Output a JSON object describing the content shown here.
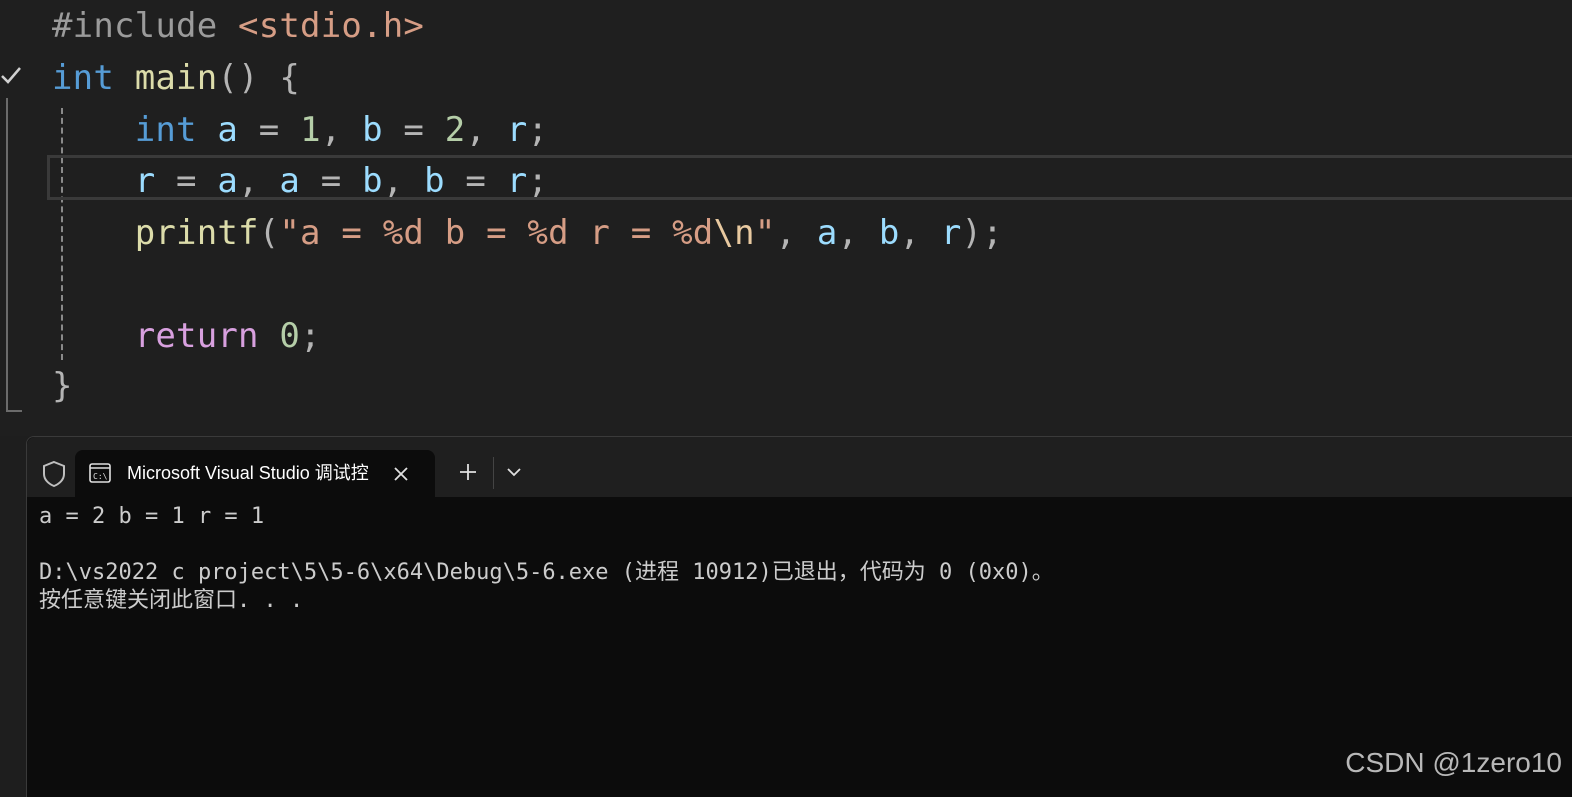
{
  "editor": {
    "lines": [
      [
        {
          "t": "#include ",
          "c": "c-pre"
        },
        {
          "t": "<stdio.h>",
          "c": "c-str"
        }
      ],
      [
        {
          "t": "int",
          "c": "c-kw"
        },
        {
          "t": " ",
          "c": "c-op"
        },
        {
          "t": "main",
          "c": "c-fn"
        },
        {
          "t": "() ",
          "c": "c-punc"
        },
        {
          "t": "{",
          "c": "c-brace"
        }
      ],
      [
        {
          "t": "    ",
          "c": "c-op"
        },
        {
          "t": "int",
          "c": "c-kw"
        },
        {
          "t": " ",
          "c": "c-op"
        },
        {
          "t": "a",
          "c": "c-var"
        },
        {
          "t": " = ",
          "c": "c-op"
        },
        {
          "t": "1",
          "c": "c-num"
        },
        {
          "t": ", ",
          "c": "c-punc"
        },
        {
          "t": "b",
          "c": "c-var"
        },
        {
          "t": " = ",
          "c": "c-op"
        },
        {
          "t": "2",
          "c": "c-num"
        },
        {
          "t": ", ",
          "c": "c-punc"
        },
        {
          "t": "r",
          "c": "c-var"
        },
        {
          "t": ";",
          "c": "c-punc"
        }
      ],
      [
        {
          "t": "    ",
          "c": "c-op"
        },
        {
          "t": "r",
          "c": "c-var"
        },
        {
          "t": " = ",
          "c": "c-op"
        },
        {
          "t": "a",
          "c": "c-var"
        },
        {
          "t": ", ",
          "c": "c-punc"
        },
        {
          "t": "a",
          "c": "c-var"
        },
        {
          "t": " = ",
          "c": "c-op"
        },
        {
          "t": "b",
          "c": "c-var"
        },
        {
          "t": ", ",
          "c": "c-punc"
        },
        {
          "t": "b",
          "c": "c-var"
        },
        {
          "t": " = ",
          "c": "c-op"
        },
        {
          "t": "r",
          "c": "c-var"
        },
        {
          "t": ";",
          "c": "c-punc"
        }
      ],
      [
        {
          "t": "    ",
          "c": "c-op"
        },
        {
          "t": "printf",
          "c": "c-fn"
        },
        {
          "t": "(",
          "c": "c-punc"
        },
        {
          "t": "\"a = %d b = %d r = %d",
          "c": "c-str"
        },
        {
          "t": "\\n",
          "c": "c-esc"
        },
        {
          "t": "\"",
          "c": "c-str"
        },
        {
          "t": ", ",
          "c": "c-punc"
        },
        {
          "t": "a",
          "c": "c-var"
        },
        {
          "t": ", ",
          "c": "c-punc"
        },
        {
          "t": "b",
          "c": "c-var"
        },
        {
          "t": ", ",
          "c": "c-punc"
        },
        {
          "t": "r",
          "c": "c-var"
        },
        {
          "t": ");",
          "c": "c-punc"
        }
      ],
      [],
      [
        {
          "t": "    ",
          "c": "c-op"
        },
        {
          "t": "return",
          "c": "c-ret"
        },
        {
          "t": " ",
          "c": "c-op"
        },
        {
          "t": "0",
          "c": "c-num"
        },
        {
          "t": ";",
          "c": "c-punc"
        }
      ],
      [
        {
          "t": "}",
          "c": "c-brace"
        }
      ]
    ]
  },
  "terminal": {
    "tab_title": "Microsoft Visual Studio 调试控",
    "output": [
      "a = 2 b = 1 r = 1",
      "",
      "D:\\vs2022 c project\\5\\5-6\\x64\\Debug\\5-6.exe (进程 10912)已退出，代码为 0 (0x0)。",
      "按任意键关闭此窗口. . ."
    ]
  },
  "watermark": "CSDN @1zero10",
  "colors": {
    "keyword": "#569cd6",
    "function": "#dcdcaa",
    "variable": "#9cdcfe",
    "number": "#b5cea8",
    "string": "#d69d85",
    "return": "#d8a0df"
  },
  "icons": [
    "check-icon",
    "shield-icon",
    "terminal-icon",
    "close-icon",
    "plus-icon",
    "chevron-down-icon"
  ]
}
